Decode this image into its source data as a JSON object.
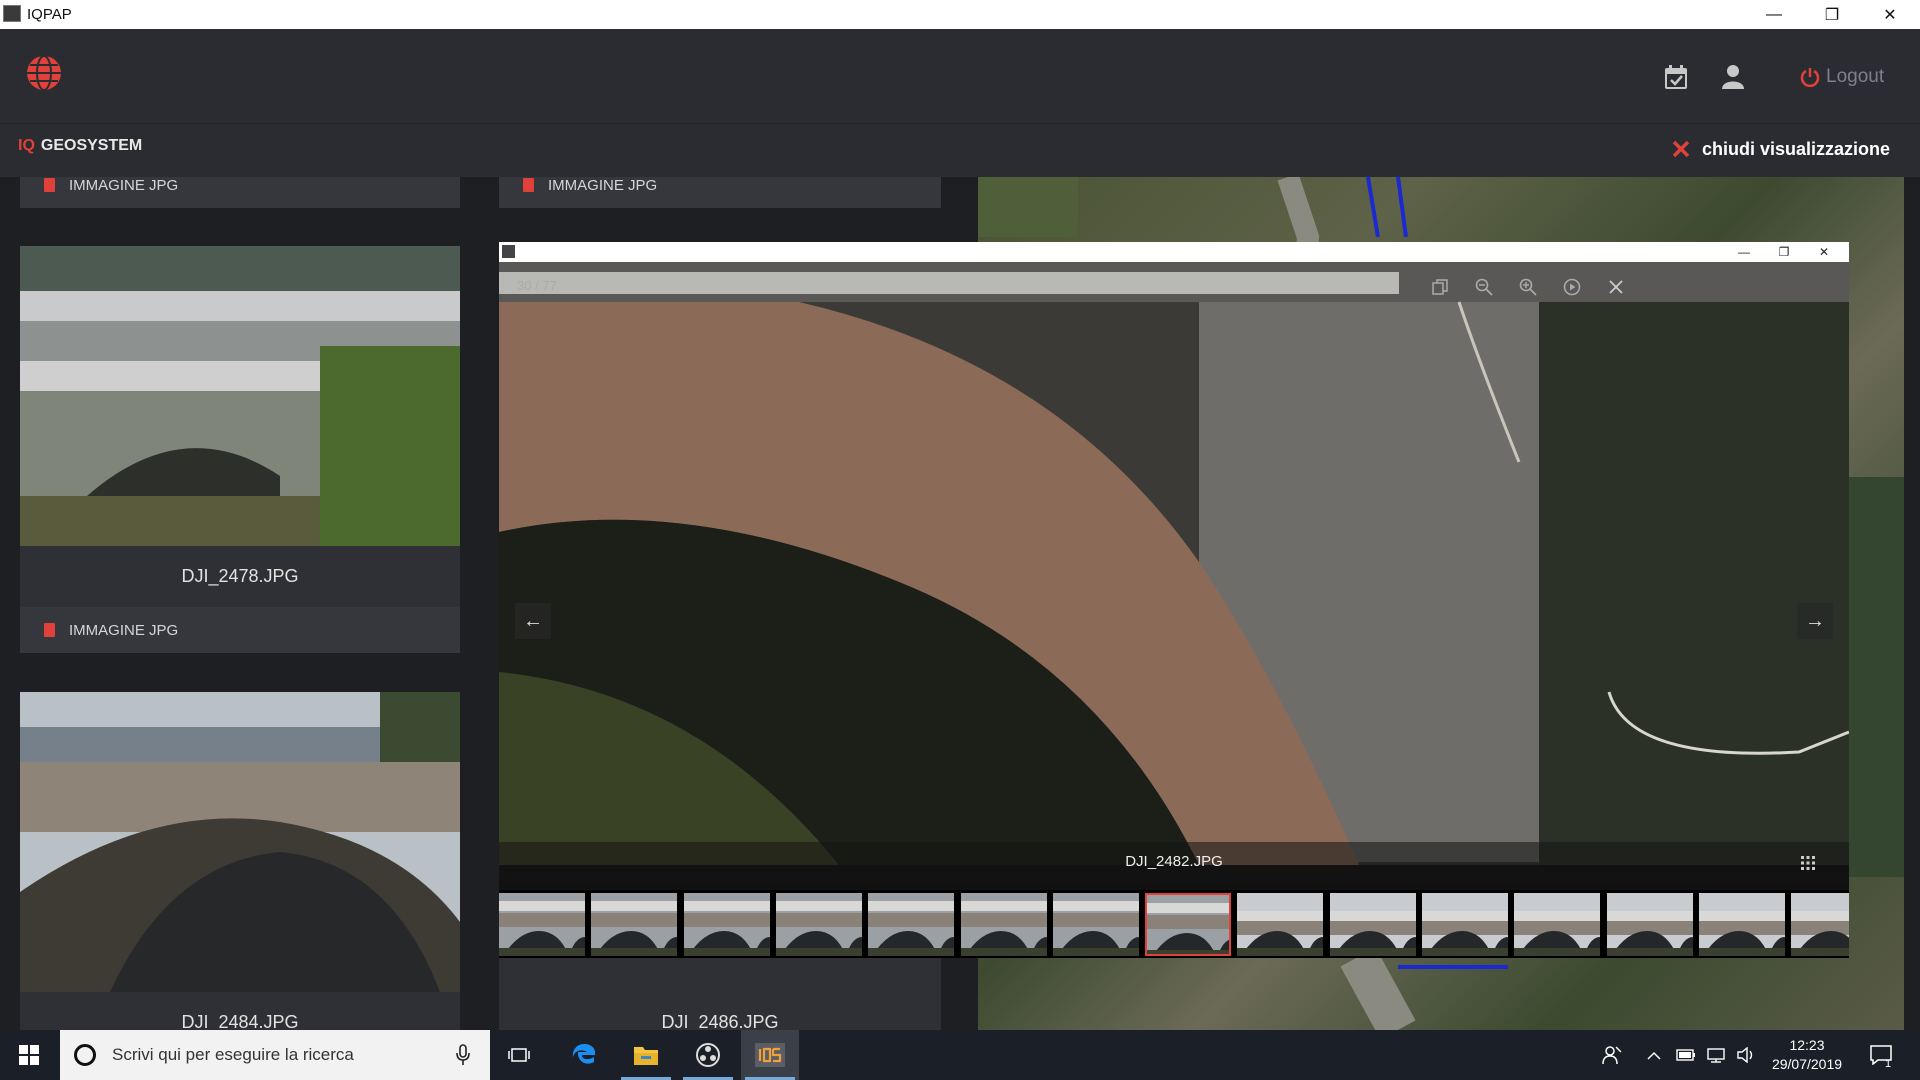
{
  "window": {
    "title": "IQPAP"
  },
  "header": {
    "logout_label": "Logout"
  },
  "subheader": {
    "brand_prefix": "IQ",
    "brand_name": "GEOSYSTEM",
    "close_label": "chiudi visualizzazione"
  },
  "cards": [
    {
      "type_label": "IMMAGINE JPG"
    },
    {
      "type_label": "IMMAGINE JPG"
    },
    {
      "filename": "DJI_2478.JPG",
      "type_label": "IMMAGINE JPG"
    },
    {
      "filename": "DJI_2484.JPG"
    },
    {
      "filename": "DJI_2486.JPG"
    }
  ],
  "viewer": {
    "counter": "30 / 77",
    "caption": "DJI_2482.JPG",
    "active_thumbnail_index": 7,
    "thumbnail_count": 15
  },
  "taskbar": {
    "search_placeholder": "Scrivi qui per eseguire la ricerca",
    "time": "12:23",
    "date": "29/07/2019",
    "notification_count": "1"
  },
  "colors": {
    "accent": "#e0413a",
    "header_bg": "#2a2c31"
  },
  "icons": [
    "globe-icon",
    "calendar-check-icon",
    "user-icon",
    "power-icon",
    "close-x-icon",
    "pdf-icon",
    "copy-icon",
    "zoom-out-icon",
    "zoom-in-icon",
    "play-icon",
    "close-icon",
    "arrow-left-icon",
    "arrow-right-icon",
    "grid-icon",
    "windows-logo-icon",
    "search-circle-icon",
    "microphone-icon",
    "task-view-icon",
    "edge-icon",
    "file-explorer-icon",
    "obs-icon",
    "iqs-app-icon",
    "people-icon",
    "chevron-up-icon",
    "battery-icon",
    "network-icon",
    "volume-icon",
    "notification-icon"
  ]
}
